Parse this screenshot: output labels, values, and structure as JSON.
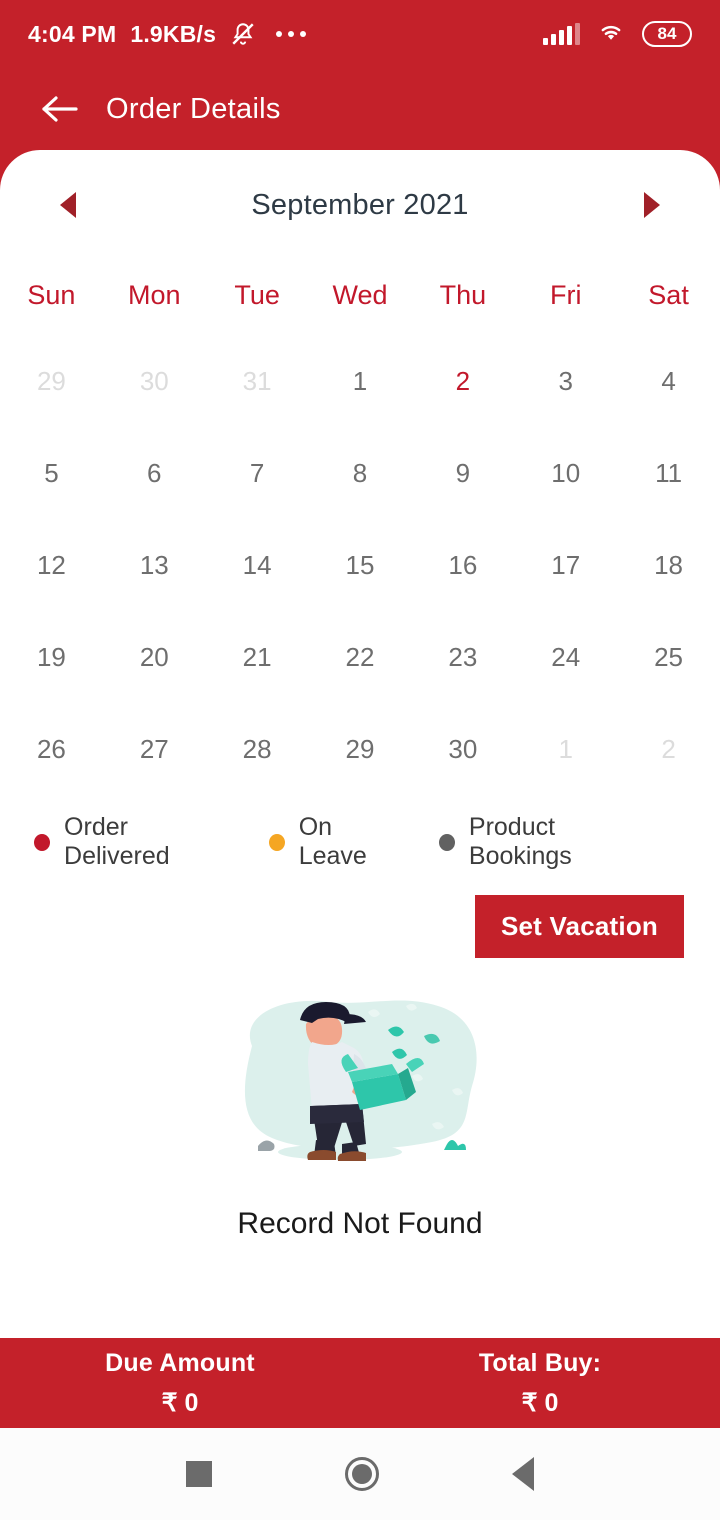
{
  "theme": {
    "primary_red": "#C4212A",
    "accent_red": "#C2182B",
    "orange": "#F5A623",
    "gray": "#616161",
    "title_color": "#2E3A45"
  },
  "status_bar": {
    "time": "4:04 PM",
    "network_speed": "1.9KB/s",
    "bell_icon": "bell-muted-icon",
    "overflow_icon": "more-dots-icon",
    "signal_icon": "signal-bars-icon",
    "wifi_icon": "wifi-icon",
    "battery_level": "84"
  },
  "app_bar": {
    "back_icon": "back-arrow-icon",
    "title": "Order Details"
  },
  "calendar": {
    "prev_icon": "chevron-left-icon",
    "next_icon": "chevron-right-icon",
    "month_title": "September 2021",
    "weekdays": [
      "Sun",
      "Mon",
      "Tue",
      "Wed",
      "Thu",
      "Fri",
      "Sat"
    ],
    "weeks": [
      [
        {
          "d": "29",
          "state": "muted"
        },
        {
          "d": "30",
          "state": "muted"
        },
        {
          "d": "31",
          "state": "muted"
        },
        {
          "d": "1",
          "state": "normal"
        },
        {
          "d": "2",
          "state": "today"
        },
        {
          "d": "3",
          "state": "normal"
        },
        {
          "d": "4",
          "state": "normal"
        }
      ],
      [
        {
          "d": "5",
          "state": "normal"
        },
        {
          "d": "6",
          "state": "normal"
        },
        {
          "d": "7",
          "state": "normal"
        },
        {
          "d": "8",
          "state": "normal"
        },
        {
          "d": "9",
          "state": "normal"
        },
        {
          "d": "10",
          "state": "normal"
        },
        {
          "d": "11",
          "state": "normal"
        }
      ],
      [
        {
          "d": "12",
          "state": "normal"
        },
        {
          "d": "13",
          "state": "normal"
        },
        {
          "d": "14",
          "state": "normal"
        },
        {
          "d": "15",
          "state": "normal"
        },
        {
          "d": "16",
          "state": "normal"
        },
        {
          "d": "17",
          "state": "normal"
        },
        {
          "d": "18",
          "state": "normal"
        }
      ],
      [
        {
          "d": "19",
          "state": "normal"
        },
        {
          "d": "20",
          "state": "normal"
        },
        {
          "d": "21",
          "state": "normal"
        },
        {
          "d": "22",
          "state": "normal"
        },
        {
          "d": "23",
          "state": "normal"
        },
        {
          "d": "24",
          "state": "normal"
        },
        {
          "d": "25",
          "state": "normal"
        }
      ],
      [
        {
          "d": "26",
          "state": "normal"
        },
        {
          "d": "27",
          "state": "normal"
        },
        {
          "d": "28",
          "state": "normal"
        },
        {
          "d": "29",
          "state": "normal"
        },
        {
          "d": "30",
          "state": "normal"
        },
        {
          "d": "1",
          "state": "muted"
        },
        {
          "d": "2",
          "state": "muted"
        }
      ]
    ]
  },
  "legend": [
    {
      "label": "Order Delivered",
      "color": "#C2182B",
      "icon": "legend-dot-icon"
    },
    {
      "label": "On Leave",
      "color": "#F5A623",
      "icon": "legend-dot-icon"
    },
    {
      "label": "Product Bookings",
      "color": "#616161",
      "icon": "legend-dot-icon"
    }
  ],
  "set_vacation_button": "Set Vacation",
  "empty_state": {
    "illustration": "man-with-box-illustration",
    "message": "Record Not Found"
  },
  "bottom_bar": {
    "cells": [
      {
        "label": "Due Amount",
        "value": "₹ 0"
      },
      {
        "label": "Total Buy:",
        "value": "₹ 0"
      }
    ]
  },
  "nav_bar": {
    "recents_icon": "square-recents-icon",
    "home_icon": "circle-home-icon",
    "back_icon": "triangle-back-icon"
  }
}
